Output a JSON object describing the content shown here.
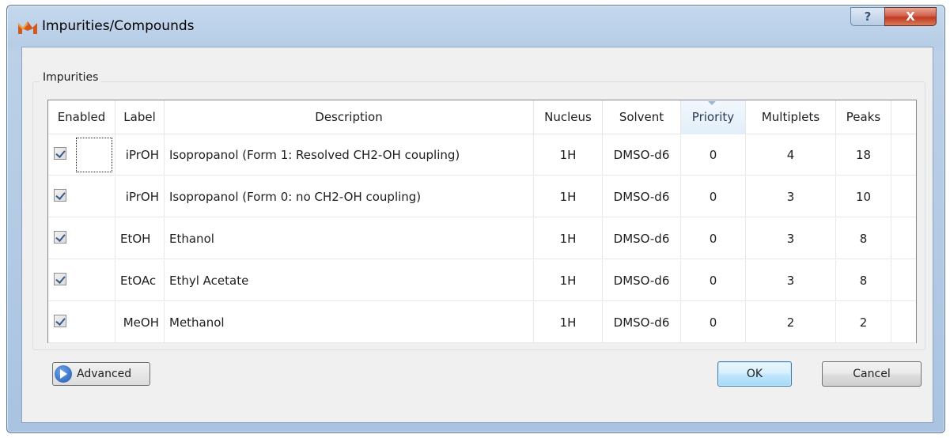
{
  "window": {
    "title": "Impurities/Compounds",
    "help_glyph": "?",
    "close_glyph": "X"
  },
  "group": {
    "label": "Impurities"
  },
  "table": {
    "columns": {
      "enabled": "Enabled",
      "label": "Label",
      "description": "Description",
      "nucleus": "Nucleus",
      "solvent": "Solvent",
      "priority": "Priority",
      "multiplets": "Multiplets",
      "peaks": "Peaks"
    },
    "sorted_column": "priority",
    "rows": [
      {
        "enabled": true,
        "label": "iPrOH",
        "description": "Isopropanol (Form 1: Resolved CH2-OH coupling)",
        "nucleus": "1H",
        "solvent": "DMSO-d6",
        "priority": "0",
        "multiplets": "4",
        "peaks": "18"
      },
      {
        "enabled": true,
        "label": "iPrOH",
        "description": "Isopropanol (Form 0: no CH2-OH coupling)",
        "nucleus": "1H",
        "solvent": "DMSO-d6",
        "priority": "0",
        "multiplets": "3",
        "peaks": "10"
      },
      {
        "enabled": true,
        "label": "EtOH",
        "description": "Ethanol",
        "nucleus": "1H",
        "solvent": "DMSO-d6",
        "priority": "0",
        "multiplets": "3",
        "peaks": "8"
      },
      {
        "enabled": true,
        "label": "EtOAc",
        "description": "Ethyl Acetate",
        "nucleus": "1H",
        "solvent": "DMSO-d6",
        "priority": "0",
        "multiplets": "3",
        "peaks": "8"
      },
      {
        "enabled": true,
        "label": "MeOH",
        "description": "Methanol",
        "nucleus": "1H",
        "solvent": "DMSO-d6",
        "priority": "0",
        "multiplets": "2",
        "peaks": "2"
      }
    ]
  },
  "buttons": {
    "advanced": "Advanced",
    "ok": "OK",
    "cancel": "Cancel"
  },
  "icons": {
    "app": "mnova-logo-icon",
    "advanced": "expand-arrow-icon"
  }
}
